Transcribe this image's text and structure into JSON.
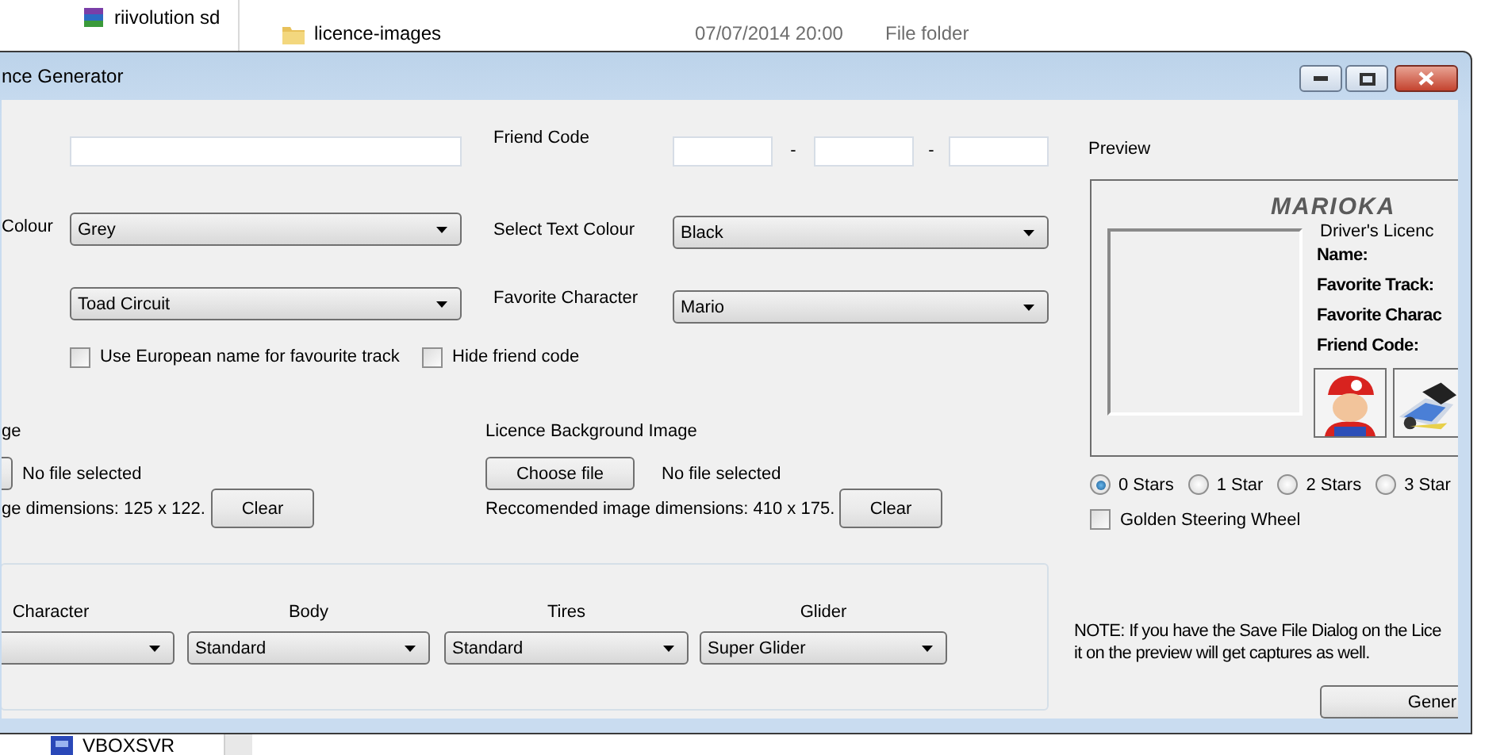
{
  "explorer": {
    "nav_items": [
      {
        "label": "riivolution sd"
      }
    ],
    "files": [
      {
        "name": "licence-images",
        "modified": "07/07/2014 20:00",
        "type": "File folder"
      }
    ],
    "nav_bottom": {
      "label": "VBOXSVR"
    }
  },
  "window": {
    "title": "nce Generator"
  },
  "friend_code": {
    "label": "Friend Code",
    "separators": [
      "-",
      "-"
    ]
  },
  "colour": {
    "label": "Colour",
    "value": "Grey"
  },
  "text_colour": {
    "label": "Select Text Colour",
    "value": "Black"
  },
  "track": {
    "value": "Toad Circuit"
  },
  "character": {
    "label": "Favorite Character",
    "value": "Mario"
  },
  "options": [
    {
      "label": "Use European name for favourite track",
      "checked": false
    },
    {
      "label": "Hide friend code",
      "checked": false
    }
  ],
  "images": [
    {
      "label": "ge",
      "file_status": "No file selected",
      "dimensions": "ge dimensions: 125 x 122.",
      "clear": "Clear"
    },
    {
      "label": "Licence Background Image",
      "choose": "Choose file",
      "file_status": "No file selected",
      "dimensions": "Reccomended image dimensions: 410 x 175.",
      "clear": "Clear"
    }
  ],
  "kart": [
    {
      "label": "Character"
    },
    {
      "label": "Body",
      "value": "Standard"
    },
    {
      "label": "Tires",
      "value": "Standard"
    },
    {
      "label": "Glider",
      "value": "Super Glider"
    }
  ],
  "preview": {
    "label": "Preview",
    "logo": "MARIOKA",
    "subtitle": "Driver's Licenc",
    "fields": [
      "Name:",
      "Favorite Track:",
      "Favorite Charac",
      "Friend Code:"
    ]
  },
  "stars": [
    {
      "label": "0 Stars",
      "selected": true
    },
    {
      "label": "1 Star",
      "selected": false
    },
    {
      "label": "2 Stars",
      "selected": false
    },
    {
      "label": "3 Star",
      "selected": false
    }
  ],
  "golden_wheel": {
    "label": "Golden Steering Wheel",
    "checked": false
  },
  "note": [
    "NOTE: If you have the Save File Dialog on the Lice",
    "it on the preview will get captures as well."
  ],
  "generate_button": "Gener"
}
